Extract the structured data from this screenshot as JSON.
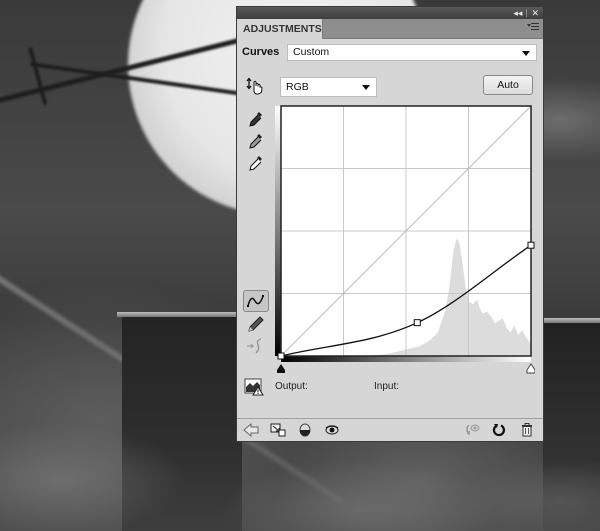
{
  "panel": {
    "tab_label": "ADJUSTMENTS",
    "titlebar_icons": [
      "collapse-icon",
      "close-icon"
    ],
    "collapse_glyph": "◂◂",
    "close_glyph": "✕",
    "adjustment_type_label": "Curves",
    "preset": {
      "selected": "Custom"
    },
    "channel": {
      "selected": "RGB"
    },
    "auto_button_label": "Auto",
    "output_label": "Output:",
    "input_label": "Input:",
    "left_tools": [
      {
        "name": "on-image-adjust-tool",
        "icon": "hand-updown-icon"
      },
      {
        "name": "black-point-eyedropper",
        "icon": "eyedropper-black-icon"
      },
      {
        "name": "gray-point-eyedropper",
        "icon": "eyedropper-gray-icon"
      },
      {
        "name": "white-point-eyedropper",
        "icon": "eyedropper-white-icon"
      },
      {
        "name": "edit-points-tool",
        "icon": "curve-points-icon",
        "active": true
      },
      {
        "name": "draw-curve-tool",
        "icon": "pencil-icon"
      },
      {
        "name": "smooth-curve-tool",
        "icon": "smooth-icon",
        "disabled": true
      }
    ],
    "bottom_icons": [
      "back-arrow-icon",
      "clip-to-layer-icon",
      "layer-visibility-toggle-icon",
      "view-previous-state-icon",
      "reset-view-icon",
      "reset-adjustment-icon",
      "delete-icon"
    ]
  },
  "chart_data": {
    "type": "line",
    "title": "Curves (RGB)",
    "xlabel": "Input",
    "ylabel": "Output",
    "xlim": [
      0,
      255
    ],
    "ylim": [
      0,
      255
    ],
    "grid": "4x4",
    "baseline": [
      [
        0,
        0
      ],
      [
        255,
        255
      ]
    ],
    "control_points": [
      [
        0,
        0
      ],
      [
        139,
        34
      ],
      [
        255,
        113
      ]
    ],
    "histogram_profile": [
      [
        0,
        0
      ],
      [
        60,
        0
      ],
      [
        90,
        0
      ],
      [
        110,
        2
      ],
      [
        120,
        4
      ],
      [
        130,
        6
      ],
      [
        140,
        8
      ],
      [
        150,
        12
      ],
      [
        160,
        20
      ],
      [
        168,
        40
      ],
      [
        172,
        60
      ],
      [
        176,
        90
      ],
      [
        179,
        100
      ],
      [
        182,
        96
      ],
      [
        185,
        80
      ],
      [
        188,
        60
      ],
      [
        192,
        46
      ],
      [
        196,
        44
      ],
      [
        200,
        48
      ],
      [
        203,
        40
      ],
      [
        206,
        36
      ],
      [
        210,
        38
      ],
      [
        214,
        34
      ],
      [
        218,
        28
      ],
      [
        222,
        30
      ],
      [
        226,
        32
      ],
      [
        230,
        24
      ],
      [
        234,
        20
      ],
      [
        238,
        26
      ],
      [
        242,
        18
      ],
      [
        246,
        22
      ],
      [
        250,
        16
      ],
      [
        255,
        10
      ]
    ],
    "histogram_note": "relative heights, 0-100 scale, peak near input 180"
  }
}
